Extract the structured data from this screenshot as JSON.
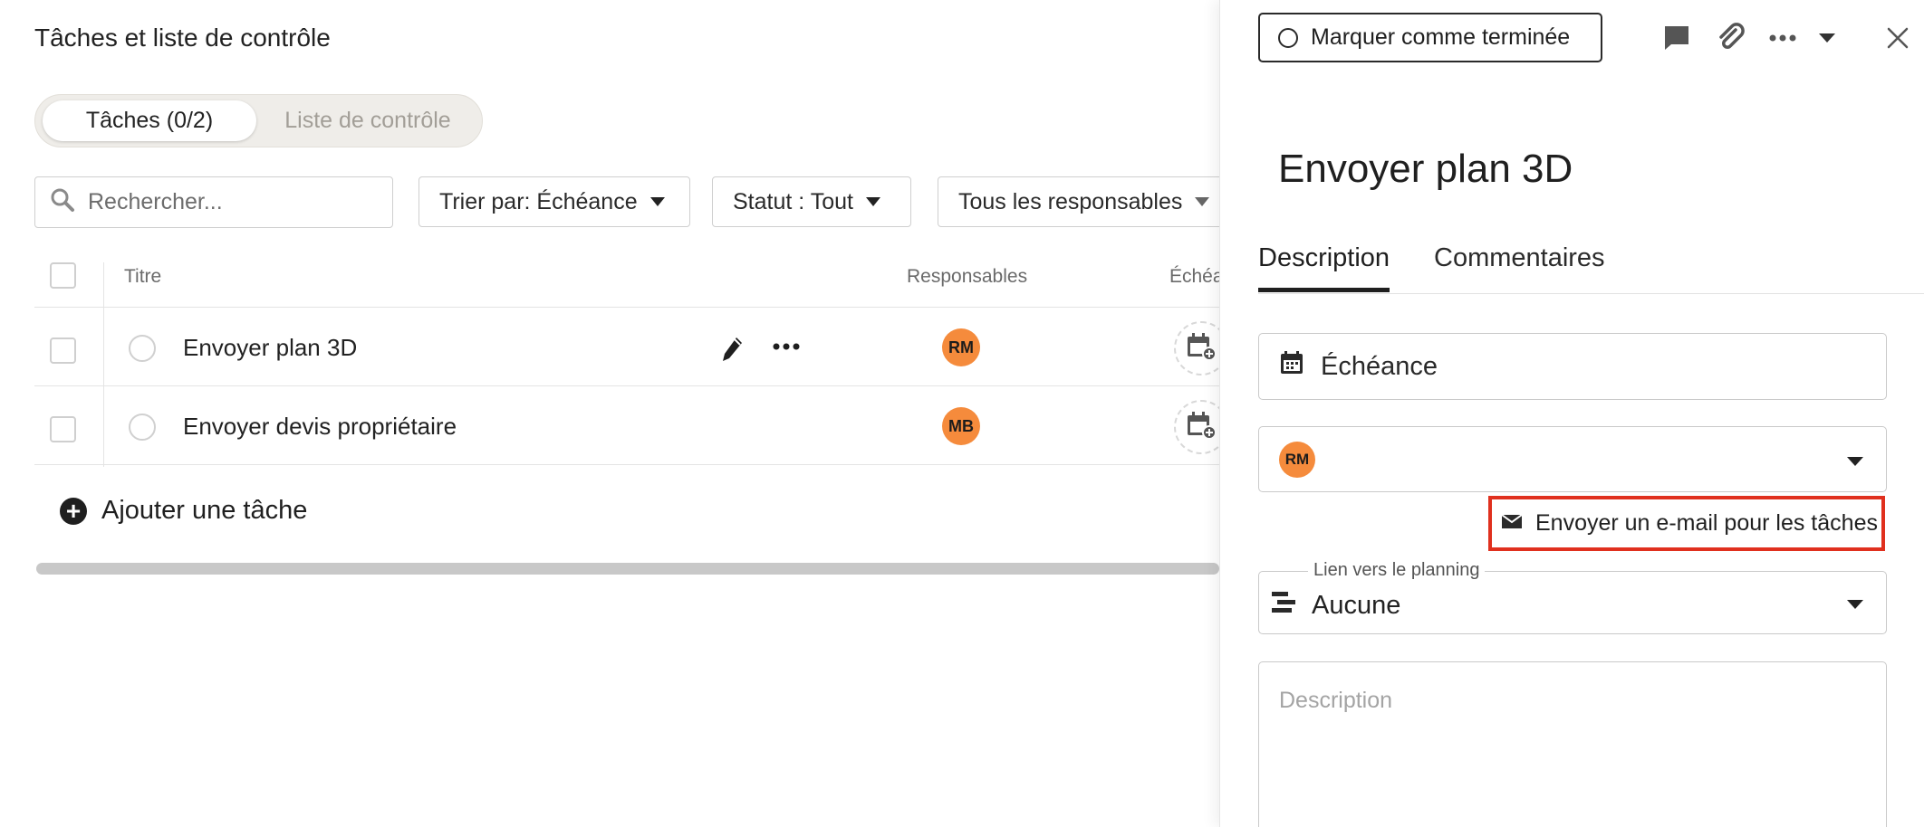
{
  "page": {
    "title": "Tâches et liste de contrôle"
  },
  "toggle": {
    "tasks_label": "Tâches (0/2)",
    "checklist_label": "Liste de contrôle"
  },
  "search": {
    "placeholder": "Rechercher..."
  },
  "filters": {
    "sort_label": "Trier par: Échéance",
    "status_label": "Statut : Tout",
    "assignees_label": "Tous les responsables"
  },
  "table": {
    "headers": {
      "title": "Titre",
      "assignees": "Responsables",
      "due": "Échéa"
    },
    "rows": [
      {
        "title": "Envoyer plan 3D",
        "assignee": "RM"
      },
      {
        "title": "Envoyer devis propriétaire",
        "assignee": "MB"
      }
    ]
  },
  "add_task_label": "Ajouter une tâche",
  "detail": {
    "complete_button": "Marquer comme terminée",
    "title": "Envoyer plan 3D",
    "tabs": [
      "Description",
      "Commentaires"
    ],
    "due_label": "Échéance",
    "assignee": "RM",
    "email_button": "Envoyer un e-mail pour les tâches",
    "planning_legend": "Lien vers le planning",
    "planning_value": "Aucune",
    "description_placeholder": "Description"
  },
  "colors": {
    "avatar": "#f58b3c",
    "highlight": "#e0301e"
  }
}
